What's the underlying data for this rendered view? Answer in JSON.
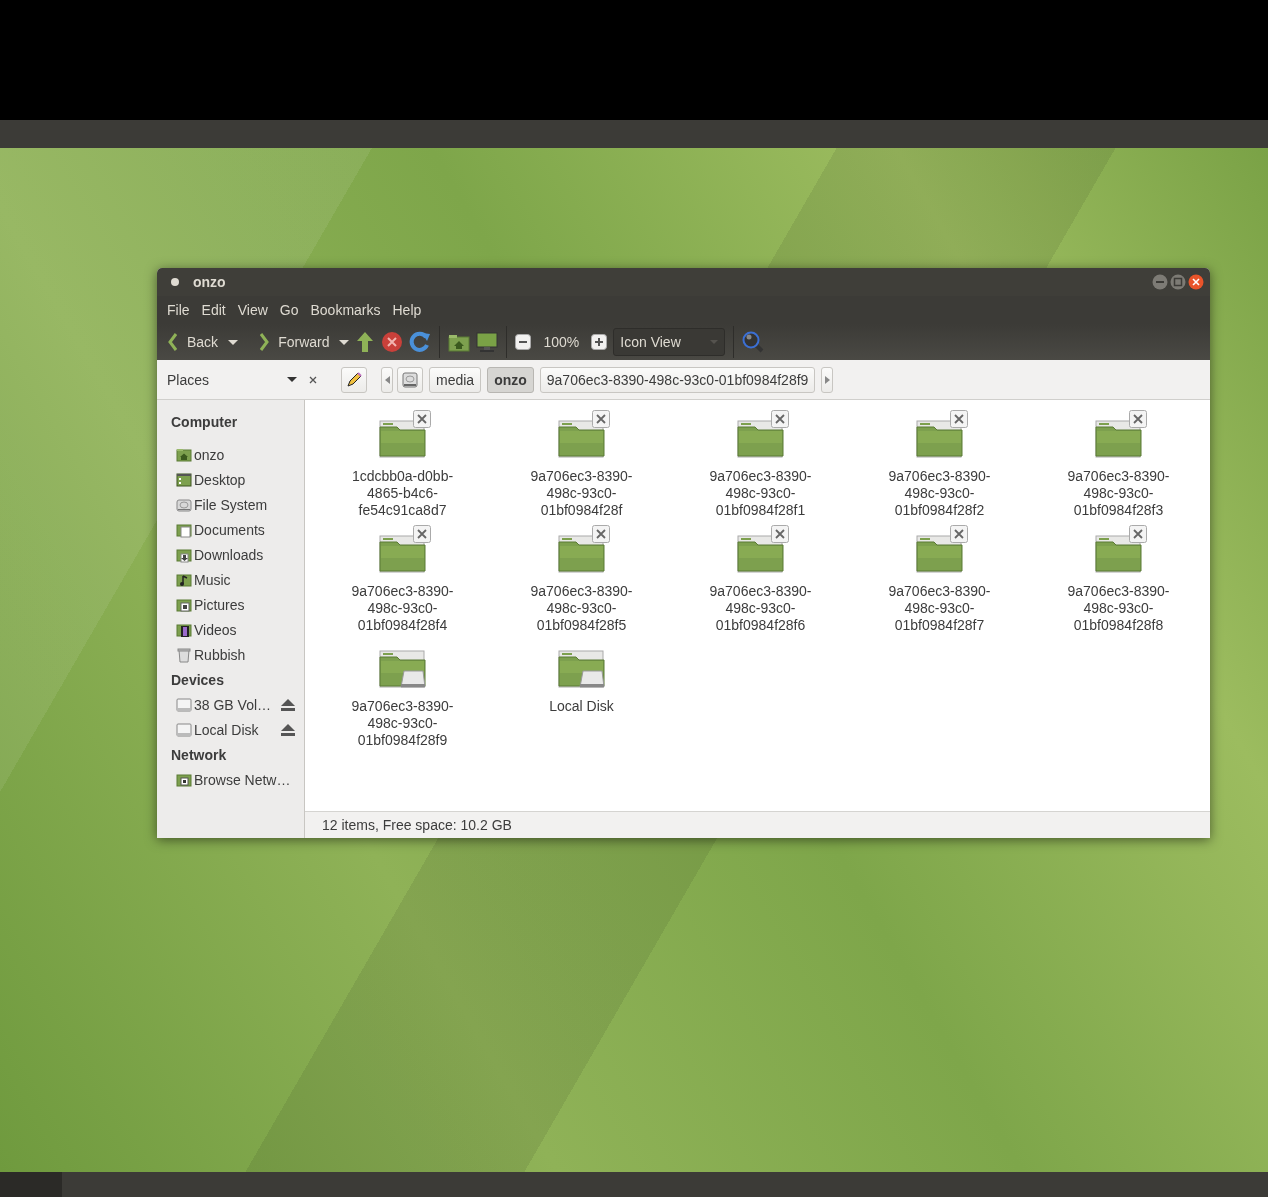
{
  "window": {
    "title": "onzo"
  },
  "menu": [
    "File",
    "Edit",
    "View",
    "Go",
    "Bookmarks",
    "Help"
  ],
  "toolbar": {
    "back": "Back",
    "forward": "Forward",
    "zoom": "100%",
    "view_mode": "Icon View"
  },
  "location_bar": {
    "side_pane": "Places",
    "path": [
      {
        "label": "media",
        "selected": false
      },
      {
        "label": "onzo",
        "selected": true
      },
      {
        "label": "9a706ec3-8390-498c-93c0-01bf0984f28f9",
        "selected": false
      }
    ]
  },
  "sidebar": {
    "sections": [
      {
        "title": "Computer",
        "items": [
          {
            "label": "onzo",
            "kind": "home",
            "eject": false
          },
          {
            "label": "Desktop",
            "kind": "desktop",
            "eject": false
          },
          {
            "label": "File System",
            "kind": "filesystem",
            "eject": false
          },
          {
            "label": "Documents",
            "kind": "documents",
            "eject": false
          },
          {
            "label": "Downloads",
            "kind": "downloads",
            "eject": false
          },
          {
            "label": "Music",
            "kind": "music",
            "eject": false
          },
          {
            "label": "Pictures",
            "kind": "pictures",
            "eject": false
          },
          {
            "label": "Videos",
            "kind": "videos",
            "eject": false
          },
          {
            "label": "Rubbish",
            "kind": "trash",
            "eject": false
          }
        ]
      },
      {
        "title": "Devices",
        "items": [
          {
            "label": "38 GB Vol…",
            "kind": "drive",
            "eject": true
          },
          {
            "label": "Local Disk",
            "kind": "drive",
            "eject": true
          }
        ]
      },
      {
        "title": "Network",
        "items": [
          {
            "label": "Browse Netw…",
            "kind": "network",
            "eject": false
          }
        ]
      }
    ]
  },
  "items": [
    {
      "name": "1cdcbb0a-d0bb-4865-b4c6-fe54c91ca8d7",
      "kind": "folder"
    },
    {
      "name": "9a706ec3-8390-498c-93c0-01bf0984f28f",
      "kind": "folder"
    },
    {
      "name": "9a706ec3-8390-498c-93c0-01bf0984f28f1",
      "kind": "folder"
    },
    {
      "name": "9a706ec3-8390-498c-93c0-01bf0984f28f2",
      "kind": "folder"
    },
    {
      "name": "9a706ec3-8390-498c-93c0-01bf0984f28f3",
      "kind": "folder"
    },
    {
      "name": "9a706ec3-8390-498c-93c0-01bf0984f28f4",
      "kind": "folder"
    },
    {
      "name": "9a706ec3-8390-498c-93c0-01bf0984f28f5",
      "kind": "folder"
    },
    {
      "name": "9a706ec3-8390-498c-93c0-01bf0984f28f6",
      "kind": "folder"
    },
    {
      "name": "9a706ec3-8390-498c-93c0-01bf0984f28f7",
      "kind": "folder"
    },
    {
      "name": "9a706ec3-8390-498c-93c0-01bf0984f28f8",
      "kind": "folder"
    },
    {
      "name": "9a706ec3-8390-498c-93c0-01bf0984f28f9",
      "kind": "mount"
    },
    {
      "name": "Local Disk",
      "kind": "mount"
    }
  ],
  "status_bar": "12 items, Free space: 10.2 GB"
}
